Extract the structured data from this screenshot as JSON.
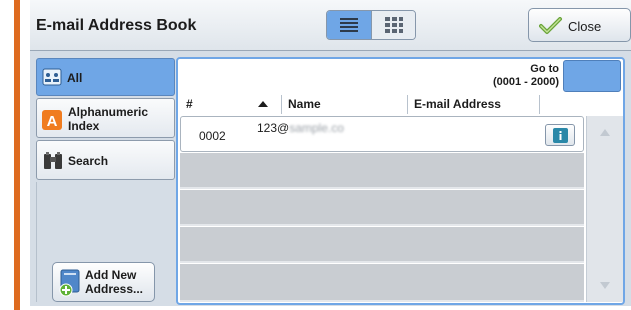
{
  "header": {
    "title": "E-mail Address Book",
    "close_label": "Close"
  },
  "view_toggle": {
    "selected": "list",
    "options": [
      "list",
      "thumbnail"
    ]
  },
  "sidebar": {
    "items": [
      {
        "label": "All",
        "icon": "address-book-icon",
        "active": true
      },
      {
        "label": "Alphanumeric Index",
        "icon": "letter-a-icon",
        "active": false
      },
      {
        "label": "Search",
        "icon": "binoculars-icon",
        "active": false
      }
    ],
    "add_button_label": "Add New Address..."
  },
  "goto": {
    "label": "Go to",
    "range": "(0001 - 2000)",
    "value": ""
  },
  "table": {
    "columns": [
      "#",
      "Name",
      "E-mail Address"
    ],
    "sort_indicator": "ascending",
    "rows": [
      {
        "number": "0002",
        "name": "123@",
        "name_obscured": "sample.co"
      }
    ]
  },
  "colors": {
    "accent_orange": "#de6b1f",
    "selected_blue": "#6fa6e6"
  }
}
